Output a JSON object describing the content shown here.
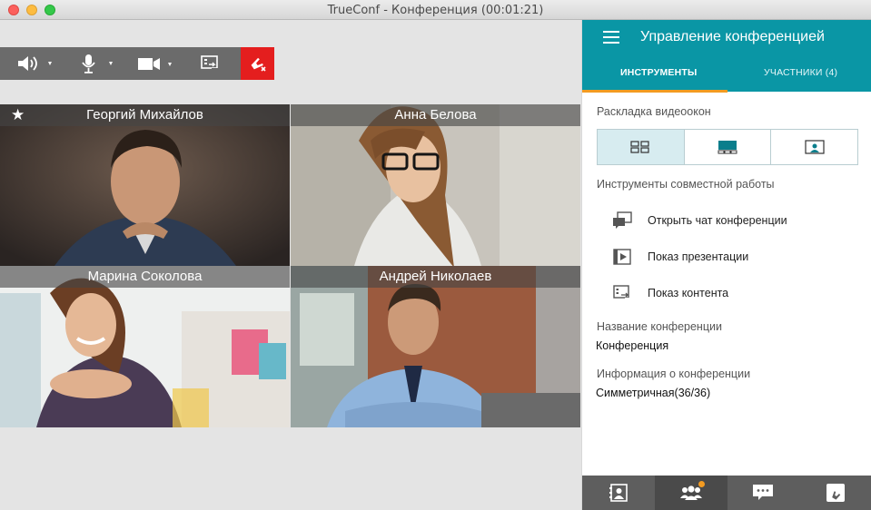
{
  "window": {
    "title": "TrueConf - Конференция (00:01:21)"
  },
  "participants": [
    {
      "name": "Георгий Михайлов",
      "starred": true
    },
    {
      "name": "Анна Белова",
      "starred": false
    },
    {
      "name": "Марина Соколова",
      "starred": false
    },
    {
      "name": "Андрей Николаев",
      "starred": false
    }
  ],
  "toolbar": {
    "speaker_icon": "speaker-icon",
    "mic_icon": "microphone-icon",
    "camera_icon": "camera-icon",
    "share_icon": "screen-share-icon",
    "hangup_icon": "hangup-icon",
    "hangup_color": "#e41e1e"
  },
  "panel": {
    "title": "Управление конференцией",
    "accent_color": "#0a96a5",
    "tab_highlight": "#f39b21",
    "tabs": [
      {
        "label": "ИНСТРУМЕНТЫ",
        "active": true
      },
      {
        "label": "УЧАСТНИКИ (4)",
        "active": false
      }
    ],
    "layout_section": "Раскладка видеоокон",
    "layouts": [
      {
        "icon": "layout-grid-icon",
        "active": true
      },
      {
        "icon": "layout-main-strip-icon",
        "active": false
      },
      {
        "icon": "layout-single-icon",
        "active": false
      }
    ],
    "tools_section": "Инструменты совместной работы",
    "tools": [
      {
        "label": "Открыть чат конференции",
        "icon": "chat-icon"
      },
      {
        "label": "Показ презентации",
        "icon": "presentation-icon"
      },
      {
        "label": "Показ контента",
        "icon": "content-share-icon"
      }
    ],
    "conf_name_label": "Название конференции",
    "conf_name_value": "Конференция",
    "conf_info_label": "Информация о конференции",
    "conf_info_value": "Симметричная(36/36)"
  },
  "bottom_bar": [
    {
      "icon": "contacts-icon",
      "active": false
    },
    {
      "icon": "participants-icon",
      "active": true,
      "badge": true
    },
    {
      "icon": "chat-bubble-icon",
      "active": false
    },
    {
      "icon": "call-icon",
      "active": false
    }
  ]
}
